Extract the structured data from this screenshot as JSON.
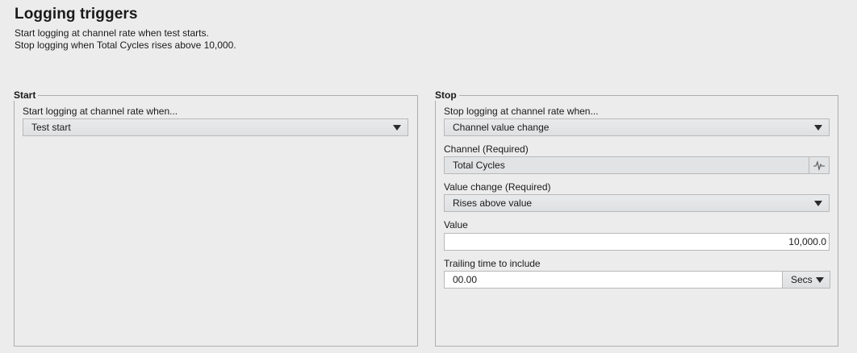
{
  "header": {
    "title": "Logging triggers",
    "summary_line1": "Start logging at channel rate when test starts.",
    "summary_line2": "Stop logging when Total Cycles rises above 10,000."
  },
  "start": {
    "group_label": "Start",
    "condition_label": "Start logging at channel rate when...",
    "condition_value": "Test start"
  },
  "stop": {
    "group_label": "Stop",
    "condition_label": "Stop logging at channel rate when...",
    "condition_value": "Channel value change",
    "channel_label": "Channel (Required)",
    "channel_value": "Total Cycles",
    "channel_button_icon": "waveform-icon",
    "value_change_label": "Value change (Required)",
    "value_change_value": "Rises above value",
    "value_label": "Value",
    "value_value": "10,000.0",
    "trailing_label": "Trailing time to include",
    "trailing_value": "00.00",
    "trailing_unit": "Secs"
  }
}
